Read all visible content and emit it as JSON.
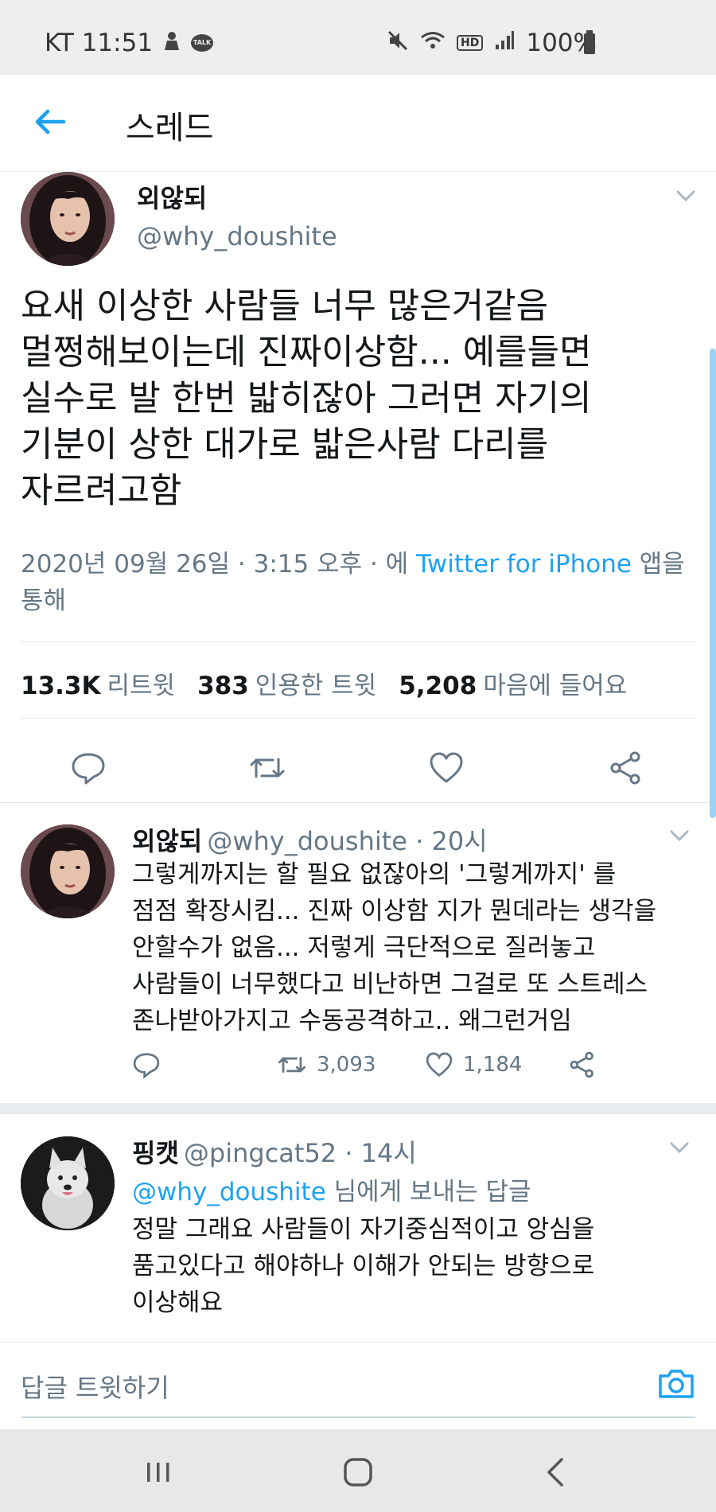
{
  "status_bar": {
    "carrier_time": "KT 11:51",
    "talk_badge": "TALK",
    "hd_label": "HD",
    "battery": "100%",
    "icons": [
      "person-icon",
      "talk-icon",
      "mute-icon",
      "wifi-icon",
      "hd-icon",
      "signal-icon",
      "battery-icon"
    ]
  },
  "header": {
    "title": "스레드",
    "back_icon": "arrow-left-icon"
  },
  "main_tweet": {
    "author_name": "외않되",
    "author_handle": "@why_doushite",
    "text": "요새 이상한 사람들 너무 많은거같음\n멀쩡해보이는데 진짜이상함... 예를들면\n실수로 발 한번 밟히잖아 그러면 자기의\n기분이 상한 대가로 밟은사람 다리를\n자르려고함",
    "timestamp": "2020년 09월 26일 · 3:15 오후 · 에 ",
    "source_app": "Twitter for iPhone",
    "source_suffix": " 앱을 통해",
    "retweets_count": "13.3K",
    "retweets_label": "리트윗",
    "quotes_count": "383",
    "quotes_label": "인용한 트윗",
    "likes_count": "5,208",
    "likes_label": "마음에 들어요"
  },
  "replies": [
    {
      "author_name": "외않되",
      "author_handle": "@why_doushite",
      "time": "· 20시",
      "text": "그렇게까지는 할 필요 없잖아의 '그렇게까지' 를\n점점 확장시킴... 진짜 이상함 지가 뭔데라는 생각을\n안할수가 없음... 저렇게 극단적으로 질러놓고\n사람들이 너무했다고 비난하면 그걸로 또 스트레스\n존나받아가지고 수동공격하고.. 왜그런거임",
      "retweets": "3,093",
      "likes": "1,184"
    },
    {
      "author_name": "핑캣",
      "author_handle": "@pingcat52",
      "time": "· 14시",
      "replying_to_mention": "@why_doushite",
      "replying_to_suffix": " 님에게 보내는 답글",
      "text": "정말 그래요 사람들이 자기중심적이고 앙심을\n품고있다고 해야하나 이해가 안되는 방향으로\n이상해요"
    }
  ],
  "composer": {
    "placeholder": "답글 트윗하기"
  },
  "colors": {
    "accent": "#1da1f2",
    "secondary_text": "#657786",
    "primary_text": "#14171a"
  }
}
